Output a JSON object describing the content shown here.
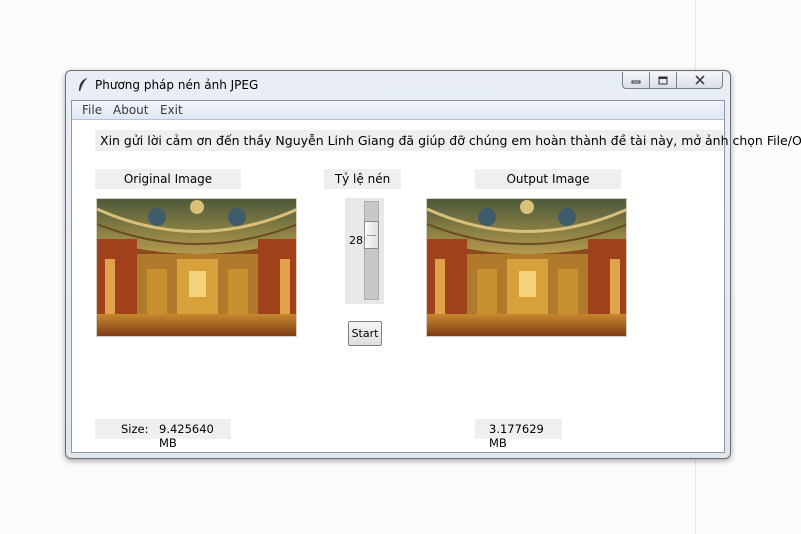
{
  "window": {
    "title": "Phương pháp nén ảnh JPEG"
  },
  "menubar": {
    "items": [
      "File",
      "About",
      "Exit"
    ]
  },
  "main": {
    "greeting": "Xin gửi lời cảm ơn đến thầy Nguyễn Linh Giang đã giúp đỡ chúng em hoàn thành đề tài này, mở ảnh chọn File/Open",
    "original_label": "Original Image",
    "output_label": "Output Image",
    "ratio_label": "Tỷ lệ nén",
    "slider": {
      "value": "28",
      "level": 0.28
    },
    "start_label": "Start",
    "size_label": "Size:",
    "original_size": "9.425640 MB",
    "output_size": "3.177629 MB"
  },
  "icons": {
    "app": "feather-icon",
    "minimize": "minimize-icon",
    "maximize": "maximize-icon",
    "close": "close-icon"
  },
  "colors": {
    "window_frame": "#dfe6ee",
    "label_bg": "#efefef",
    "menubar": "#dfe6f3"
  }
}
